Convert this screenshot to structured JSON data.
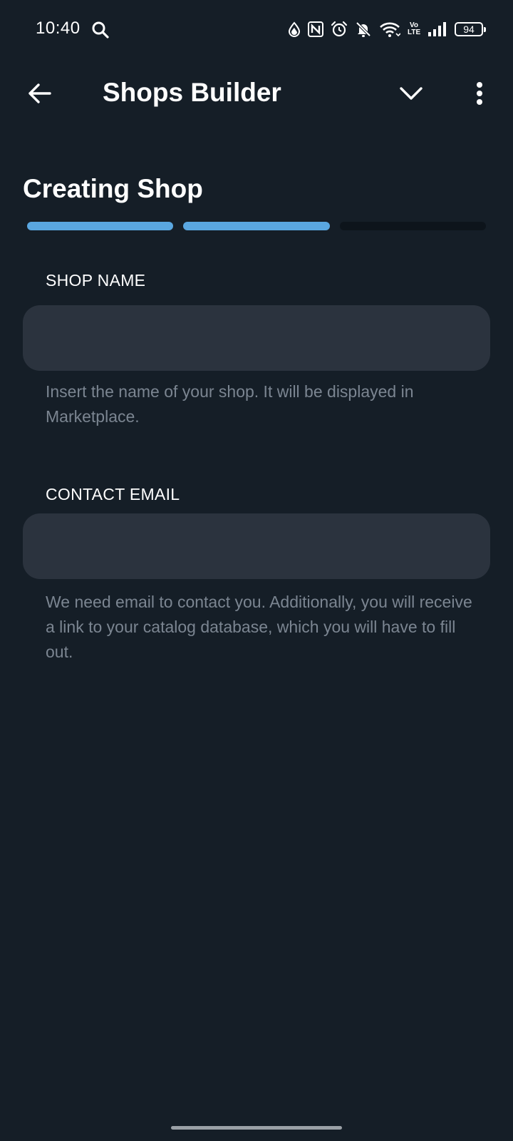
{
  "status_bar": {
    "time": "10:40",
    "volte": [
      "Vo",
      "LTE"
    ],
    "battery": "94",
    "icons": [
      "search-icon",
      "data-saver-icon",
      "nfc-icon",
      "alarm-icon",
      "mute-icon",
      "wifi-icon",
      "volte-icon",
      "signal-icon",
      "battery-icon"
    ]
  },
  "app_bar": {
    "title": "Shops Builder",
    "icons": [
      "back-arrow-icon",
      "chevron-down-icon",
      "more-vert-icon"
    ]
  },
  "page": {
    "heading": "Creating Shop",
    "progress": {
      "total_steps": 3,
      "completed_steps": 2
    }
  },
  "form": {
    "shop_name": {
      "label": "SHOP NAME",
      "value": "",
      "hint": "Insert the name of your shop. It will be displayed in Marketplace."
    },
    "contact_email": {
      "label": "CONTACT EMAIL",
      "value": "",
      "hint": "We need email to contact you. Additionally, you will receive a link to your catalog database, which you will have to fill out."
    }
  },
  "colors": {
    "background": "#151e27",
    "input_background": "#2b333e",
    "accent": "#5aa7e0",
    "hint_text": "#7b8591",
    "progress_track": "#0d141b"
  }
}
